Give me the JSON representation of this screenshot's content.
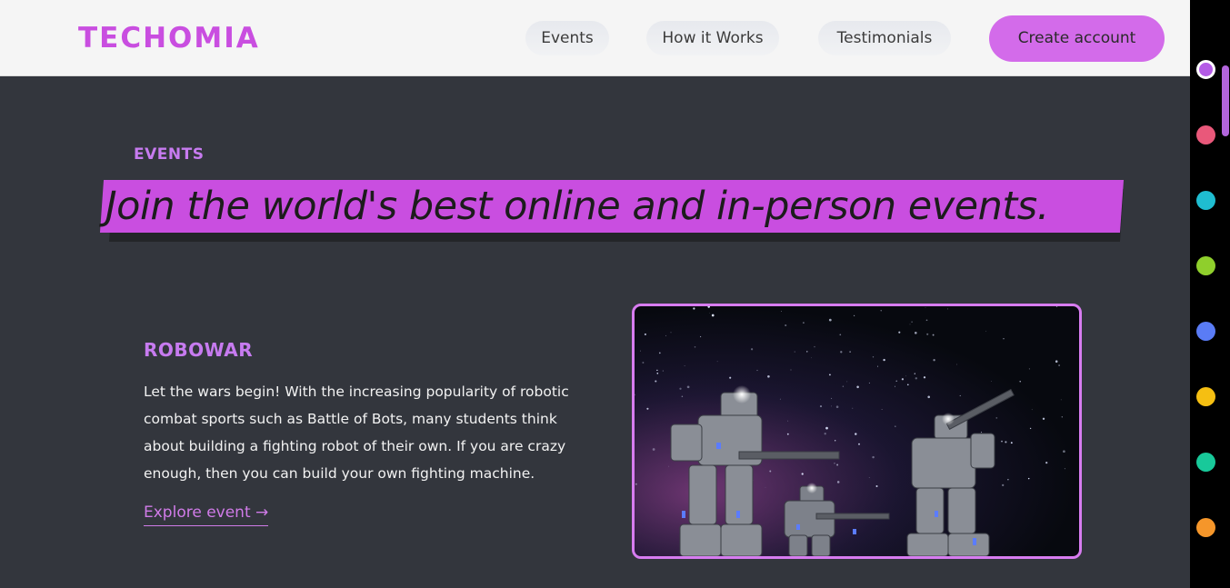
{
  "header": {
    "logo": "TECHOMIA",
    "nav": [
      "Events",
      "How it Works",
      "Testimonials"
    ],
    "cta": "Create account"
  },
  "section": {
    "eyebrow": "EVENTS",
    "headline": "Join the world's best online and in-person events."
  },
  "event": {
    "title": "ROBOWAR",
    "description": "Let the wars begin! With the increasing popularity of robotic combat sports such as Battle of Bots, many students think about building a fighting robot of their own. If you are crazy enough, then you can build your own fighting machine.",
    "link": "Explore event →",
    "image_icon": "robot-battle-image"
  },
  "theme_colors": {
    "accent": "#c94ee0",
    "background": "#33363d",
    "swatches": [
      "#b45be6",
      "#e9587a",
      "#1fbdd1",
      "#8fcf2c",
      "#5a7cf5",
      "#f5bf12",
      "#18c99a",
      "#f5962a"
    ]
  }
}
